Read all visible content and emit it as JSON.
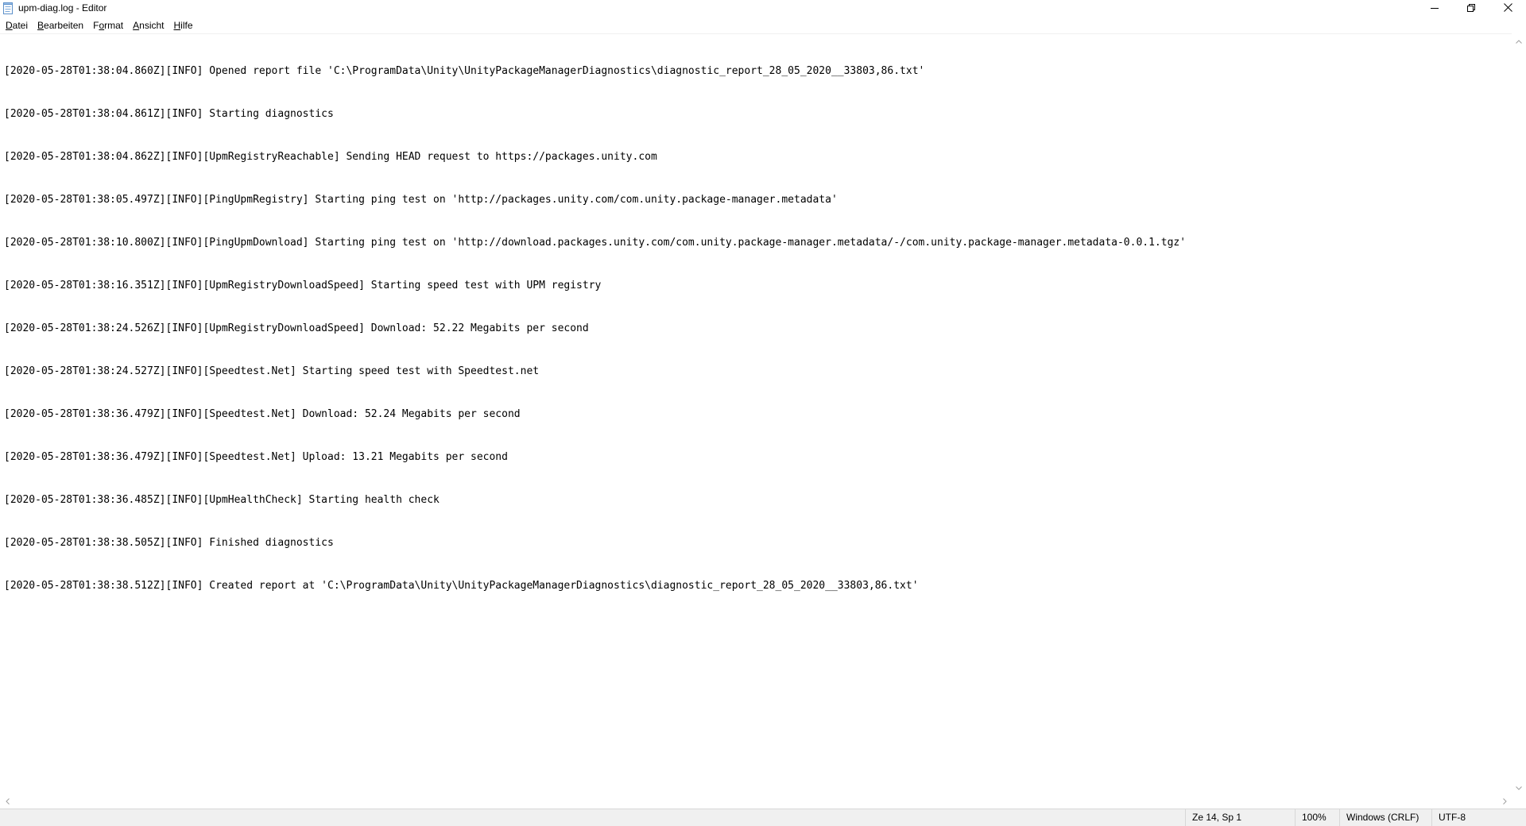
{
  "window": {
    "title": "upm-diag.log - Editor",
    "app_icon": "notepad-icon",
    "controls": {
      "minimize_icon": "minimize-icon",
      "maximize_icon": "restore-icon",
      "close_icon": "close-icon"
    }
  },
  "menu": {
    "items": [
      {
        "label": "Datei",
        "accel": "D"
      },
      {
        "label": "Bearbeiten",
        "accel": "B"
      },
      {
        "label": "Format",
        "accel": "o"
      },
      {
        "label": "Ansicht",
        "accel": "A"
      },
      {
        "label": "Hilfe",
        "accel": "H"
      }
    ]
  },
  "editor": {
    "lines": [
      "[2020-05-28T01:38:04.860Z][INFO] Opened report file 'C:\\ProgramData\\Unity\\UnityPackageManagerDiagnostics\\diagnostic_report_28_05_2020__33803,86.txt'",
      "[2020-05-28T01:38:04.861Z][INFO] Starting diagnostics",
      "[2020-05-28T01:38:04.862Z][INFO][UpmRegistryReachable] Sending HEAD request to https://packages.unity.com",
      "[2020-05-28T01:38:05.497Z][INFO][PingUpmRegistry] Starting ping test on 'http://packages.unity.com/com.unity.package-manager.metadata'",
      "[2020-05-28T01:38:10.800Z][INFO][PingUpmDownload] Starting ping test on 'http://download.packages.unity.com/com.unity.package-manager.metadata/-/com.unity.package-manager.metadata-0.0.1.tgz'",
      "[2020-05-28T01:38:16.351Z][INFO][UpmRegistryDownloadSpeed] Starting speed test with UPM registry",
      "[2020-05-28T01:38:24.526Z][INFO][UpmRegistryDownloadSpeed] Download: 52.22 Megabits per second",
      "[2020-05-28T01:38:24.527Z][INFO][Speedtest.Net] Starting speed test with Speedtest.net",
      "[2020-05-28T01:38:36.479Z][INFO][Speedtest.Net] Download: 52.24 Megabits per second",
      "[2020-05-28T01:38:36.479Z][INFO][Speedtest.Net] Upload: 13.21 Megabits per second",
      "[2020-05-28T01:38:36.485Z][INFO][UpmHealthCheck] Starting health check",
      "[2020-05-28T01:38:38.505Z][INFO] Finished diagnostics",
      "[2020-05-28T01:38:38.512Z][INFO] Created report at 'C:\\ProgramData\\Unity\\UnityPackageManagerDiagnostics\\diagnostic_report_28_05_2020__33803,86.txt'"
    ]
  },
  "statusbar": {
    "position": "Ze 14, Sp 1",
    "zoom": "100%",
    "line_ending": "Windows (CRLF)",
    "encoding": "UTF-8"
  },
  "scrollbars": {
    "up_icon": "scroll-up-arrow-icon",
    "down_icon": "scroll-down-arrow-icon",
    "left_icon": "scroll-left-arrow-icon",
    "right_icon": "scroll-right-arrow-icon"
  }
}
